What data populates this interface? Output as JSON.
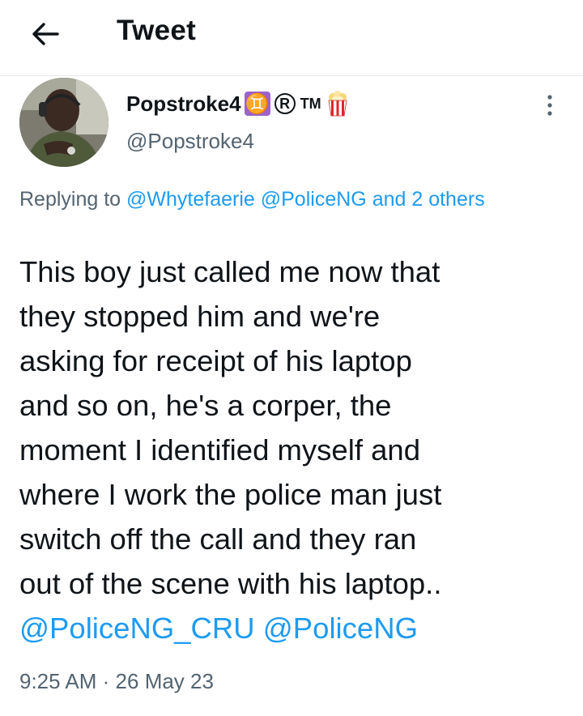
{
  "header": {
    "title": "Tweet"
  },
  "author": {
    "display_name": "Popstroke4",
    "badges": {
      "gemini": "♊",
      "registered": "R",
      "trademark": "TM",
      "popcorn_icon": "popcorn-icon"
    },
    "handle": "@Popstroke4"
  },
  "reply_context": {
    "prefix": "Replying to",
    "mention_1": "@Whytefaerie",
    "mention_2": "@PoliceNG",
    "conjunction": "and",
    "others": "2 others"
  },
  "tweet": {
    "lines": [
      "This boy just called me now that",
      "they stopped him and we're",
      "asking for receipt of his laptop",
      "and so on, he's a corper, the",
      "moment I identified myself and",
      "where I work the police man just",
      "switch off the call and they ran",
      "out of the scene with his laptop.."
    ],
    "mention_1": "@PoliceNG_CRU",
    "mention_2": "@PoliceNG"
  },
  "meta": {
    "time": "9:25 AM",
    "separator": "·",
    "date": "26 May 23"
  },
  "colors": {
    "link": "#1d9bf0",
    "secondary_text": "#536471",
    "primary_text": "#0f1419",
    "divider": "#e7e9ea"
  }
}
